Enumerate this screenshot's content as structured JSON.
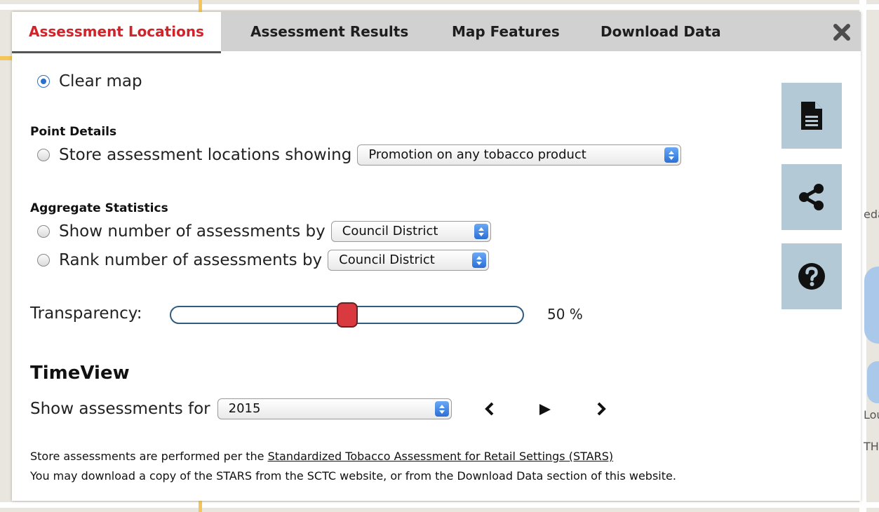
{
  "tabs": [
    {
      "label": "Assessment Locations",
      "active": true
    },
    {
      "label": "Assessment Results",
      "active": false
    },
    {
      "label": "Map Features",
      "active": false
    },
    {
      "label": "Download Data",
      "active": false
    }
  ],
  "clear_map": {
    "label": "Clear map",
    "checked": true
  },
  "point_details": {
    "heading": "Point Details",
    "label": "Store assessment locations showing",
    "selected": "Promotion on any tobacco product"
  },
  "aggregate": {
    "heading": "Aggregate Statistics",
    "show": {
      "label": "Show number of assessments by",
      "selected": "Council District"
    },
    "rank": {
      "label": "Rank number of assessments by",
      "selected": "Council District"
    }
  },
  "transparency": {
    "label": "Transparency:",
    "value": 50,
    "value_text": "50 %"
  },
  "timeview": {
    "heading": "TimeView",
    "label": "Show assessments for",
    "selected": "2015"
  },
  "footer": {
    "line1_prefix": "Store assessments are performed per the ",
    "line1_link": "Standardized Tobacco Assessment for Retail Settings (STARS)",
    "line2": "You may download a copy of the STARS from the SCTC website, or from the Download Data section of this website."
  },
  "map_labels": {
    "a": "eda",
    "b": "Lou",
    "c": "TH"
  },
  "colors": {
    "active_tab": "#d2232a",
    "slider_handle": "#d83a3f",
    "side_button": "#b3c9d5",
    "radio_checked": "#2a6fc9"
  },
  "icons": [
    "close-icon",
    "document-icon",
    "share-icon",
    "help-icon",
    "prev-icon",
    "play-icon",
    "next-icon"
  ]
}
